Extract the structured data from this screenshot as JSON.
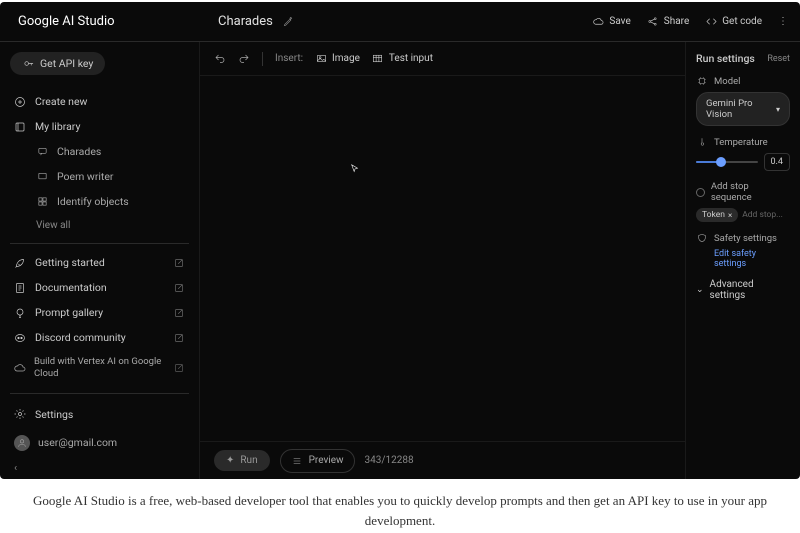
{
  "app_name": "Google AI Studio",
  "prompt_title": "Charades",
  "top_actions": {
    "save": "Save",
    "share": "Share",
    "get_code": "Get code"
  },
  "sidebar": {
    "api_key": "Get API key",
    "create_new": "Create new",
    "my_library": "My library",
    "library_items": [
      "Charades",
      "Poem writer",
      "Identify objects"
    ],
    "view_all": "View all",
    "links": {
      "getting_started": "Getting started",
      "documentation": "Documentation",
      "prompt_gallery": "Prompt gallery",
      "discord": "Discord community"
    },
    "build_vertex": "Build with Vertex AI on Google Cloud",
    "settings": "Settings",
    "user_email": "user@gmail.com"
  },
  "toolbar": {
    "insert_label": "Insert:",
    "image": "Image",
    "test_input": "Test input"
  },
  "bottom": {
    "run": "Run",
    "preview": "Preview",
    "tokens": "343/12288"
  },
  "run_settings": {
    "title": "Run settings",
    "reset": "Reset",
    "model_label": "Model",
    "model_value": "Gemini Pro Vision",
    "temperature_label": "Temperature",
    "temperature_value": "0.4",
    "temperature_percent": 40,
    "stop_label": "Add stop sequence",
    "stop_token": "Token",
    "stop_placeholder": "Add stop...",
    "safety_label": "Safety settings",
    "safety_link": "Edit safety settings",
    "advanced": "Advanced settings"
  },
  "caption": "Google AI Studio is a free, web-based developer tool that enables you to quickly develop prompts and then get an API key to use in your app development."
}
